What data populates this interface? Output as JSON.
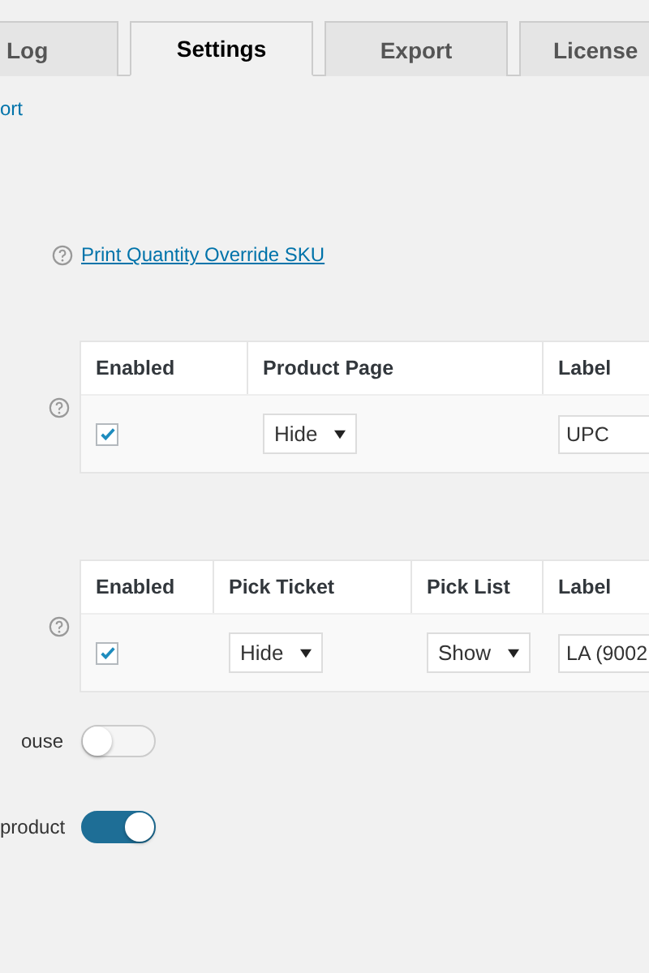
{
  "tabs": [
    {
      "label": "Log",
      "selected": false
    },
    {
      "label": "Settings",
      "selected": true
    },
    {
      "label": "Export",
      "selected": false
    },
    {
      "label": "License",
      "selected": false
    }
  ],
  "top_link": "ort",
  "print_quantity_link": "Print Quantity Override SKU",
  "tables": [
    {
      "columns": [
        "Enabled",
        "Product Page",
        "Label"
      ],
      "rows": [
        {
          "cells": [
            {
              "kind": "checkbox",
              "checked": true
            },
            {
              "kind": "select",
              "value": "Hide"
            },
            {
              "kind": "input",
              "value": "UPC"
            }
          ]
        }
      ]
    },
    {
      "columns": [
        "Enabled",
        "Pick Ticket",
        "Pick List",
        "Label"
      ],
      "rows": [
        {
          "cells": [
            {
              "kind": "checkbox",
              "checked": true
            },
            {
              "kind": "select",
              "value": "Hide"
            },
            {
              "kind": "select",
              "value": "Show"
            },
            {
              "kind": "input",
              "value": "LA (9002"
            }
          ]
        }
      ]
    }
  ],
  "toggles": [
    {
      "label": "ouse",
      "on": false
    },
    {
      "label": "product",
      "on": true
    }
  ]
}
